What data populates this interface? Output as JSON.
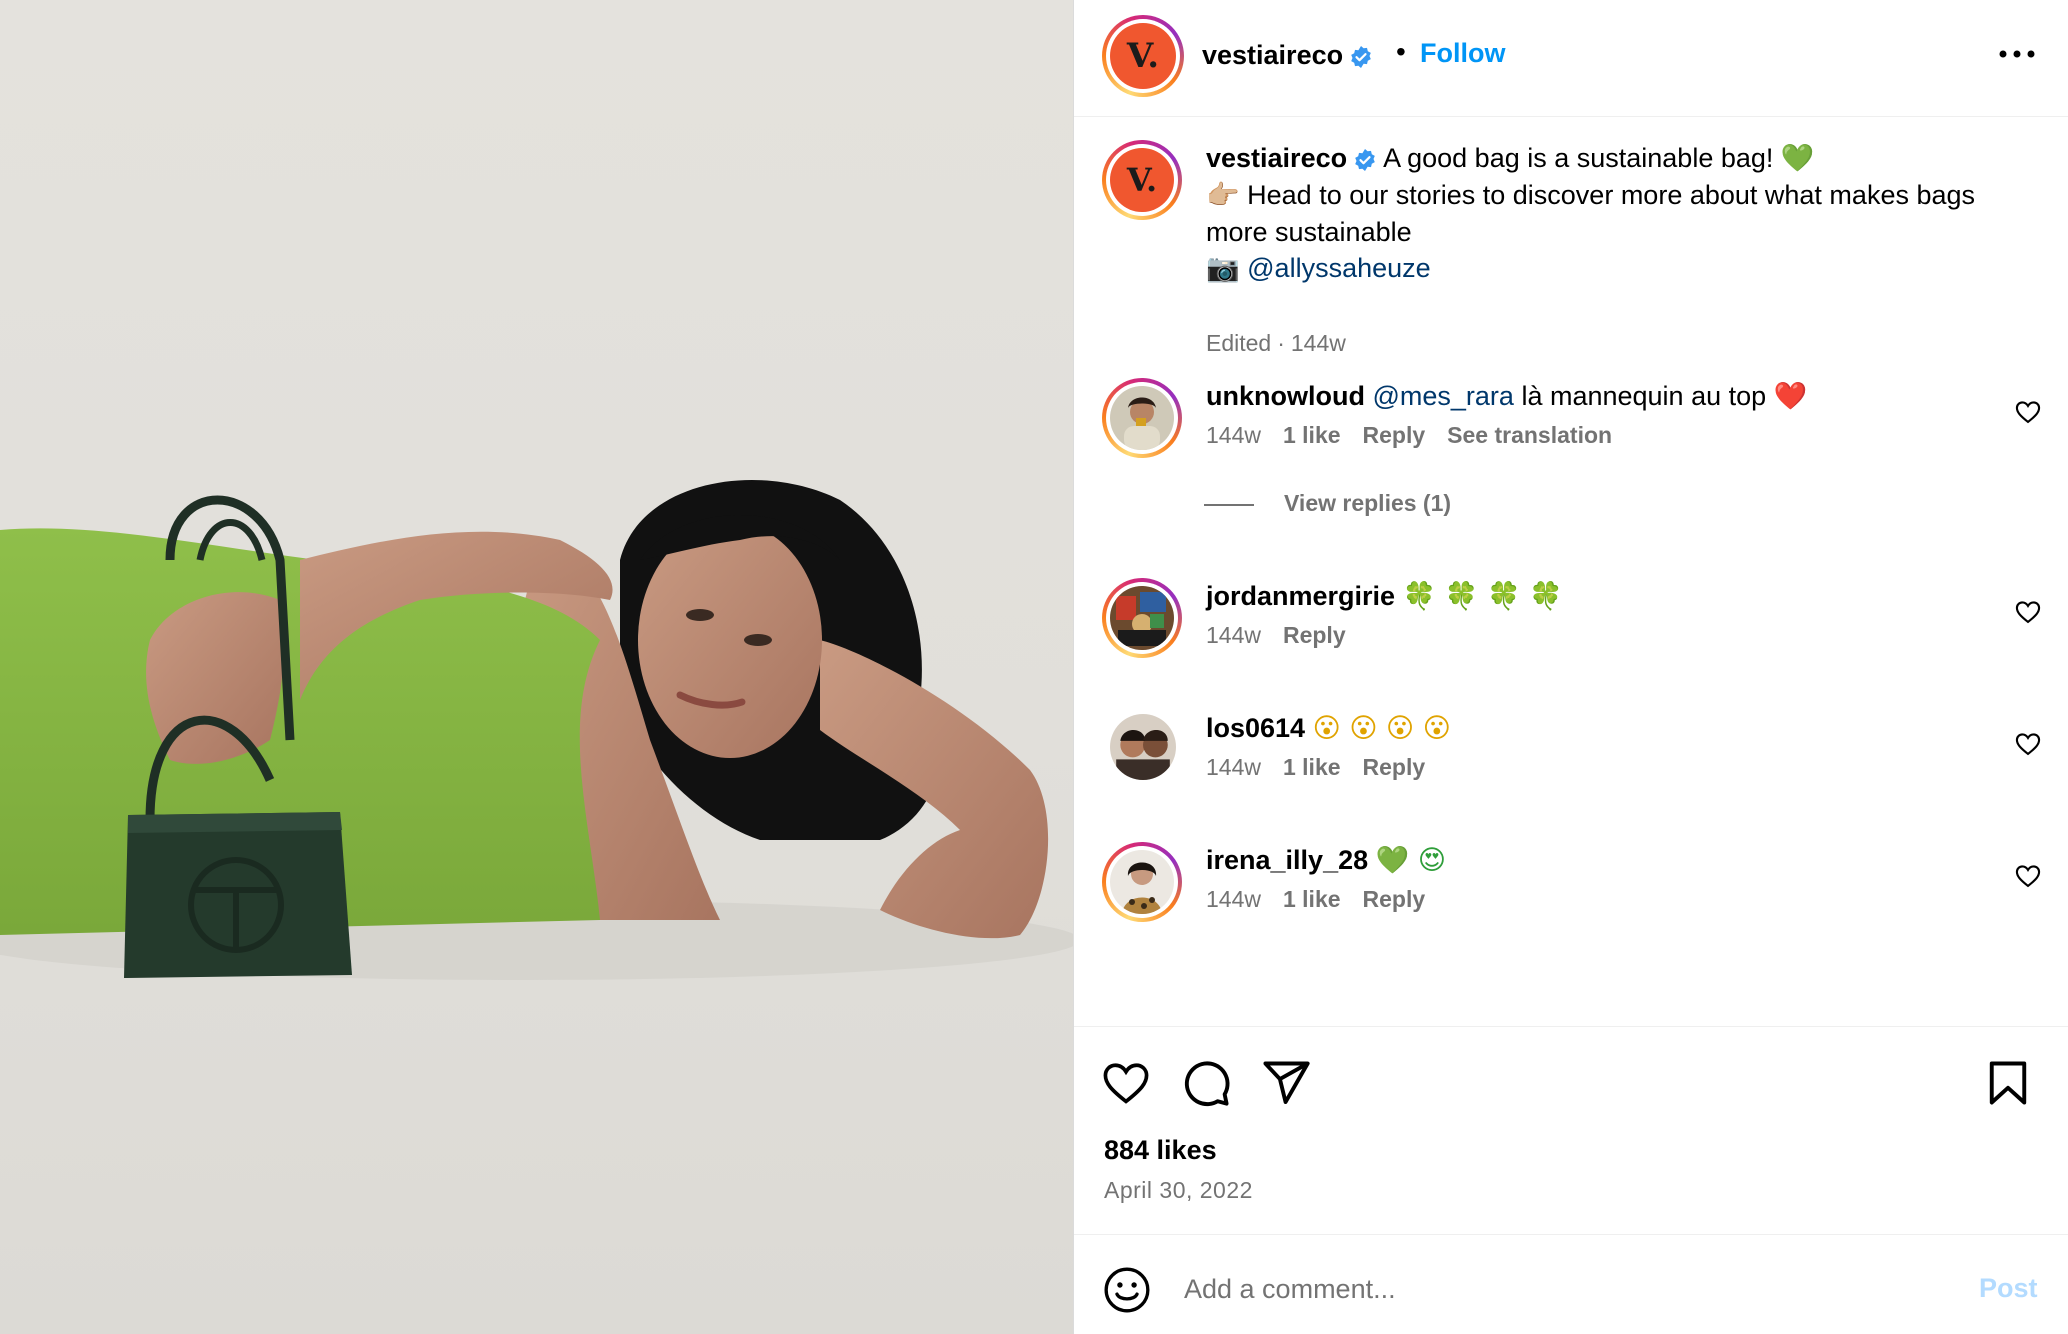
{
  "colors": {
    "accent": "#0095f6",
    "secondary_text": "#737373",
    "mention": "#00376b",
    "brand_logo": "#f0572f",
    "verified": "#3897f0",
    "post_disabled": "#b3dbff"
  },
  "header": {
    "avatar_letter": "V.",
    "username": "vestiaireco",
    "separator": "•",
    "follow_label": "Follow"
  },
  "caption": {
    "username": "vestiaireco",
    "line1": "A good bag is a sustainable bag!",
    "line1_emoji": "💚",
    "line2_emoji": "👉🏼",
    "line2": "Head to our stories to discover more about what makes bags more sustainable",
    "line3_emoji": "📷",
    "photo_credit": "@allyssaheuze",
    "edited": "Edited",
    "sep": "·",
    "time": "144w"
  },
  "comments": [
    {
      "username": "unknowloud",
      "mention": "@mes_rara",
      "text": "là mannequin au top",
      "emoji": "❤️",
      "time": "144w",
      "likes": "1 like",
      "reply": "Reply",
      "translation": "See translation",
      "view_replies": "View replies (1)"
    },
    {
      "username": "jordanmergirie",
      "emoji": "🍀 🍀 🍀 🍀",
      "time": "144w",
      "reply": "Reply"
    },
    {
      "username": "los0614",
      "emoji": "😮 😮 😮 😮",
      "time": "144w",
      "likes": "1 like",
      "reply": "Reply"
    },
    {
      "username": "irena_illy_28",
      "emoji": "💚 😍",
      "time": "144w",
      "likes": "1 like",
      "reply": "Reply"
    }
  ],
  "actions": {
    "like_icon": "heart-icon",
    "comment_icon": "comment-icon",
    "share_icon": "paper-plane-icon",
    "save_icon": "bookmark-icon"
  },
  "stats": {
    "likes": "884 likes",
    "date": "April 30, 2022"
  },
  "add_comment": {
    "placeholder": "Add a comment...",
    "post_label": "Post"
  }
}
